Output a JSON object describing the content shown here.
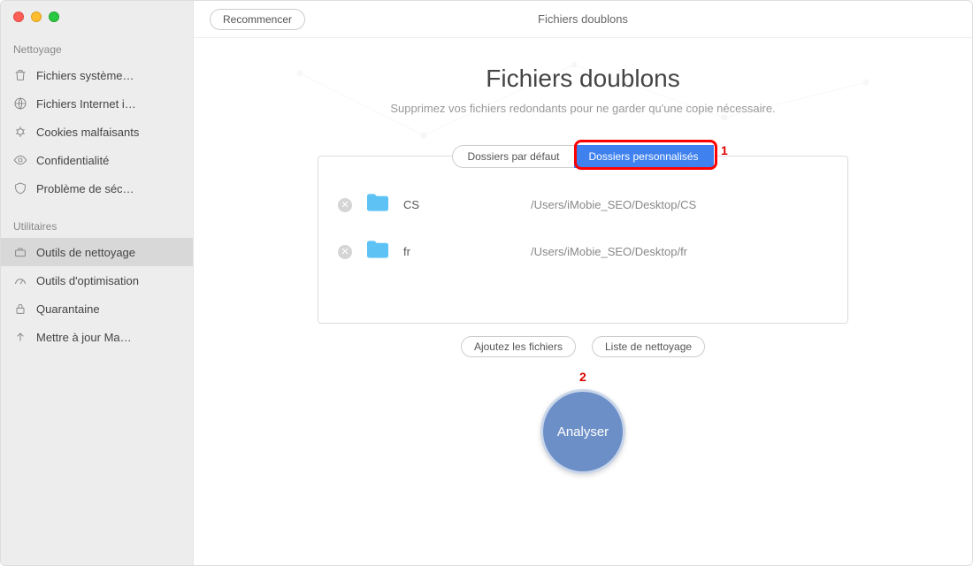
{
  "sidebar": {
    "sections": [
      {
        "title": "Nettoyage",
        "items": [
          {
            "label": "Fichiers système…"
          },
          {
            "label": "Fichiers Internet i…"
          },
          {
            "label": "Cookies malfaisants"
          },
          {
            "label": "Confidentialité"
          },
          {
            "label": "Problème de séc…"
          }
        ]
      },
      {
        "title": "Utilitaires",
        "items": [
          {
            "label": "Outils de nettoyage"
          },
          {
            "label": "Outils d'optimisation"
          },
          {
            "label": "Quarantaine"
          },
          {
            "label": "Mettre à jour Ma…"
          }
        ]
      }
    ]
  },
  "topbar": {
    "restart_label": "Recommencer",
    "title": "Fichiers doublons"
  },
  "page": {
    "title": "Fichiers doublons",
    "subtitle": "Supprimez vos fichiers redondants pour ne garder qu'une copie nécessaire."
  },
  "tabs": {
    "default": "Dossiers par défaut",
    "custom": "Dossiers personnalisés"
  },
  "folders": [
    {
      "name": "CS",
      "path": "/Users/iMobie_SEO/Desktop/CS"
    },
    {
      "name": "fr",
      "path": "/Users/iMobie_SEO/Desktop/fr"
    }
  ],
  "buttons": {
    "add_files": "Ajoutez les fichiers",
    "clean_list": "Liste de nettoyage",
    "analyze": "Analyser"
  },
  "callouts": {
    "one": "1",
    "two": "2"
  },
  "colors": {
    "accent_blue": "#3f82ef",
    "circle_blue": "#6d8fc7",
    "folder_blue": "#5ec2f5",
    "highlight_red": "#ff0000"
  }
}
